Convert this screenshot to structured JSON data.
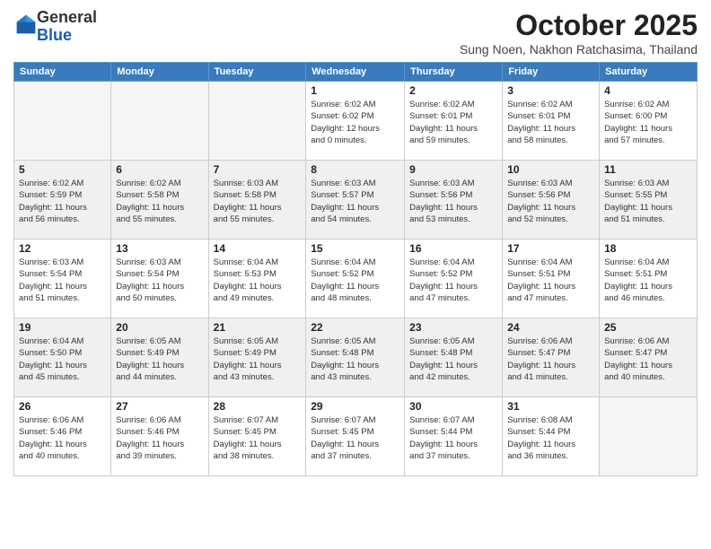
{
  "header": {
    "logo_general": "General",
    "logo_blue": "Blue",
    "month_year": "October 2025",
    "location": "Sung Noen, Nakhon Ratchasima, Thailand"
  },
  "weekdays": [
    "Sunday",
    "Monday",
    "Tuesday",
    "Wednesday",
    "Thursday",
    "Friday",
    "Saturday"
  ],
  "weeks": [
    [
      {
        "day": "",
        "info": ""
      },
      {
        "day": "",
        "info": ""
      },
      {
        "day": "",
        "info": ""
      },
      {
        "day": "1",
        "info": "Sunrise: 6:02 AM\nSunset: 6:02 PM\nDaylight: 12 hours\nand 0 minutes."
      },
      {
        "day": "2",
        "info": "Sunrise: 6:02 AM\nSunset: 6:01 PM\nDaylight: 11 hours\nand 59 minutes."
      },
      {
        "day": "3",
        "info": "Sunrise: 6:02 AM\nSunset: 6:01 PM\nDaylight: 11 hours\nand 58 minutes."
      },
      {
        "day": "4",
        "info": "Sunrise: 6:02 AM\nSunset: 6:00 PM\nDaylight: 11 hours\nand 57 minutes."
      }
    ],
    [
      {
        "day": "5",
        "info": "Sunrise: 6:02 AM\nSunset: 5:59 PM\nDaylight: 11 hours\nand 56 minutes."
      },
      {
        "day": "6",
        "info": "Sunrise: 6:02 AM\nSunset: 5:58 PM\nDaylight: 11 hours\nand 55 minutes."
      },
      {
        "day": "7",
        "info": "Sunrise: 6:03 AM\nSunset: 5:58 PM\nDaylight: 11 hours\nand 55 minutes."
      },
      {
        "day": "8",
        "info": "Sunrise: 6:03 AM\nSunset: 5:57 PM\nDaylight: 11 hours\nand 54 minutes."
      },
      {
        "day": "9",
        "info": "Sunrise: 6:03 AM\nSunset: 5:56 PM\nDaylight: 11 hours\nand 53 minutes."
      },
      {
        "day": "10",
        "info": "Sunrise: 6:03 AM\nSunset: 5:56 PM\nDaylight: 11 hours\nand 52 minutes."
      },
      {
        "day": "11",
        "info": "Sunrise: 6:03 AM\nSunset: 5:55 PM\nDaylight: 11 hours\nand 51 minutes."
      }
    ],
    [
      {
        "day": "12",
        "info": "Sunrise: 6:03 AM\nSunset: 5:54 PM\nDaylight: 11 hours\nand 51 minutes."
      },
      {
        "day": "13",
        "info": "Sunrise: 6:03 AM\nSunset: 5:54 PM\nDaylight: 11 hours\nand 50 minutes."
      },
      {
        "day": "14",
        "info": "Sunrise: 6:04 AM\nSunset: 5:53 PM\nDaylight: 11 hours\nand 49 minutes."
      },
      {
        "day": "15",
        "info": "Sunrise: 6:04 AM\nSunset: 5:52 PM\nDaylight: 11 hours\nand 48 minutes."
      },
      {
        "day": "16",
        "info": "Sunrise: 6:04 AM\nSunset: 5:52 PM\nDaylight: 11 hours\nand 47 minutes."
      },
      {
        "day": "17",
        "info": "Sunrise: 6:04 AM\nSunset: 5:51 PM\nDaylight: 11 hours\nand 47 minutes."
      },
      {
        "day": "18",
        "info": "Sunrise: 6:04 AM\nSunset: 5:51 PM\nDaylight: 11 hours\nand 46 minutes."
      }
    ],
    [
      {
        "day": "19",
        "info": "Sunrise: 6:04 AM\nSunset: 5:50 PM\nDaylight: 11 hours\nand 45 minutes."
      },
      {
        "day": "20",
        "info": "Sunrise: 6:05 AM\nSunset: 5:49 PM\nDaylight: 11 hours\nand 44 minutes."
      },
      {
        "day": "21",
        "info": "Sunrise: 6:05 AM\nSunset: 5:49 PM\nDaylight: 11 hours\nand 43 minutes."
      },
      {
        "day": "22",
        "info": "Sunrise: 6:05 AM\nSunset: 5:48 PM\nDaylight: 11 hours\nand 43 minutes."
      },
      {
        "day": "23",
        "info": "Sunrise: 6:05 AM\nSunset: 5:48 PM\nDaylight: 11 hours\nand 42 minutes."
      },
      {
        "day": "24",
        "info": "Sunrise: 6:06 AM\nSunset: 5:47 PM\nDaylight: 11 hours\nand 41 minutes."
      },
      {
        "day": "25",
        "info": "Sunrise: 6:06 AM\nSunset: 5:47 PM\nDaylight: 11 hours\nand 40 minutes."
      }
    ],
    [
      {
        "day": "26",
        "info": "Sunrise: 6:06 AM\nSunset: 5:46 PM\nDaylight: 11 hours\nand 40 minutes."
      },
      {
        "day": "27",
        "info": "Sunrise: 6:06 AM\nSunset: 5:46 PM\nDaylight: 11 hours\nand 39 minutes."
      },
      {
        "day": "28",
        "info": "Sunrise: 6:07 AM\nSunset: 5:45 PM\nDaylight: 11 hours\nand 38 minutes."
      },
      {
        "day": "29",
        "info": "Sunrise: 6:07 AM\nSunset: 5:45 PM\nDaylight: 11 hours\nand 37 minutes."
      },
      {
        "day": "30",
        "info": "Sunrise: 6:07 AM\nSunset: 5:44 PM\nDaylight: 11 hours\nand 37 minutes."
      },
      {
        "day": "31",
        "info": "Sunrise: 6:08 AM\nSunset: 5:44 PM\nDaylight: 11 hours\nand 36 minutes."
      },
      {
        "day": "",
        "info": ""
      }
    ]
  ]
}
